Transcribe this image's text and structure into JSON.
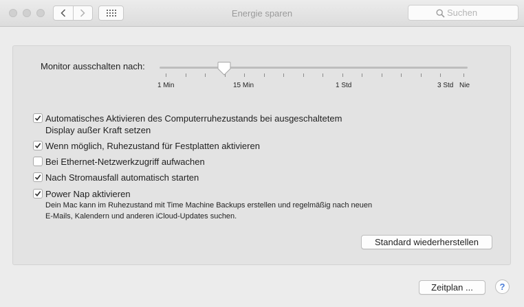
{
  "window": {
    "title": "Energie sparen",
    "search_placeholder": "Suchen"
  },
  "slider": {
    "label": "Monitor ausschalten nach:",
    "tick_labels": [
      "1 Min",
      "15 Min",
      "1 Std",
      "3 Std",
      "Nie"
    ],
    "value": "15 Min"
  },
  "options": [
    {
      "label_line1": "Automatisches Aktivieren des Computerruhezustands bei ausgeschaltetem",
      "label_line2": "Display außer Kraft setzen",
      "checked": true
    },
    {
      "label_line1": "Wenn möglich, Ruhezustand für Festplatten aktivieren",
      "checked": true
    },
    {
      "label_line1": "Bei Ethernet-Netzwerkzugriff aufwachen",
      "checked": false
    },
    {
      "label_line1": "Nach Stromausfall automatisch starten",
      "checked": true
    },
    {
      "label_line1": "Power Nap aktivieren",
      "checked": true
    }
  ],
  "power_nap_hint": {
    "line1": "Dein Mac kann im Ruhezustand mit Time Machine Backups erstellen und regelmäßig nach neuen",
    "line2": "E-Mails, Kalendern und anderen iCloud-Updates suchen."
  },
  "buttons": {
    "restore_defaults": "Standard wiederherstellen",
    "schedule": "Zeitplan ...",
    "help": "?"
  },
  "colors": {
    "accent": "#4a7dd9",
    "background": "#ececec",
    "panel": "#e3e3e3"
  },
  "icons": {
    "back": "chevron-left-icon",
    "forward": "chevron-right-icon",
    "show_all": "grid-icon",
    "search": "search-icon"
  }
}
